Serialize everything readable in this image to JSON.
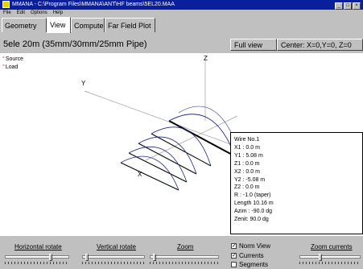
{
  "window": {
    "title": "MMANA - C:\\Program Files\\MMANA\\ANT\\HF beams\\5EL20.MAA"
  },
  "menu": [
    "File",
    "Edit",
    "Options",
    "Help"
  ],
  "tabs": [
    {
      "label": "Geometry",
      "active": false
    },
    {
      "label": "View",
      "active": true
    },
    {
      "label": "Compute",
      "active": false
    },
    {
      "label": "Far Field Plot",
      "active": false
    }
  ],
  "header": {
    "model_title": "5ele 20m (35mm/30mm/25mm Pipe)",
    "full_view_label": "Full view",
    "center_label": "Center: X=0,Y=0, Z=0"
  },
  "viewport": {
    "legend": [
      {
        "label": "Source",
        "mark": "°"
      },
      {
        "label": "Load",
        "mark": "°"
      }
    ],
    "axis_labels": {
      "x": "X",
      "y": "Y",
      "z": "Z"
    },
    "wire_info": {
      "lines": [
        "Wire No.1",
        "X1  : 0.0 m",
        "Y1  : 5.08 m",
        "Z1  : 0.0 m",
        "X2  : 0.0 m",
        "Y2  : -5.08 m",
        "Z2  : 0.0 m",
        "R    : -1.0 (taper)",
        "Length 10.16 m",
        "Azim : -90.0 dg",
        "Zenit: 90.0 dg"
      ]
    }
  },
  "controls": {
    "horizontal_rotate_label": "Horizontal rotate",
    "vertical_rotate_label": "Vertical rotate",
    "zoom_label": "Zoom",
    "zoom_currents_label": "Zoom currents",
    "norm_view_label": "Norm View",
    "currents_label": "Currents",
    "segments_label": "Segments",
    "norm_view_checked": true,
    "currents_checked": true,
    "segments_checked": false
  },
  "colors": {
    "titlebar": "#0a1f9e",
    "legend_mark": "#d00000",
    "current_curve": "#1f2a88",
    "element": "#000000"
  }
}
